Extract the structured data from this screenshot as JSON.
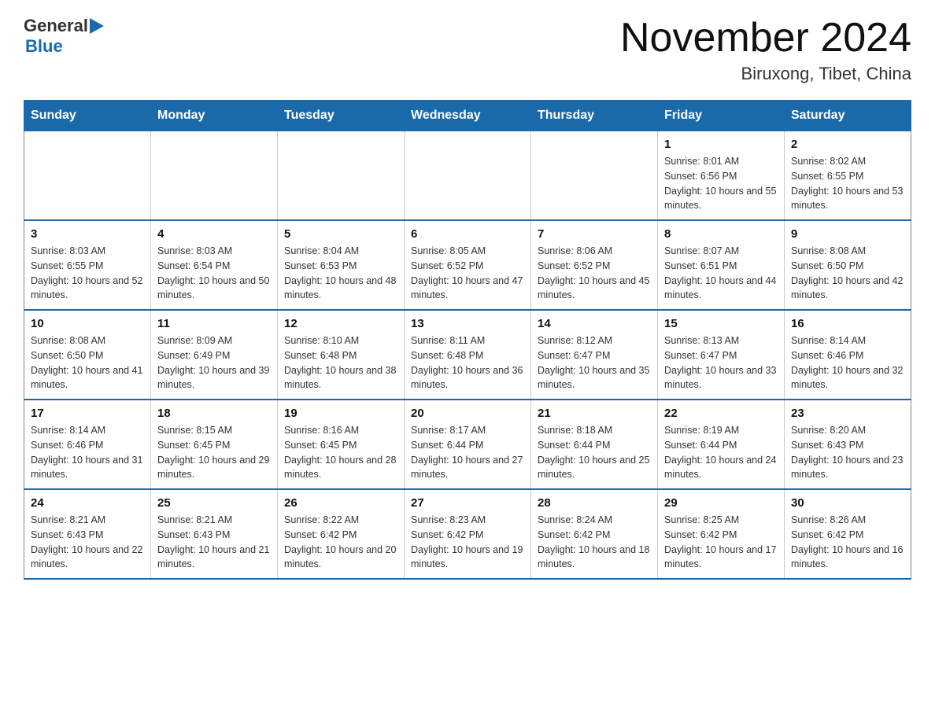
{
  "header": {
    "logo_general": "General",
    "logo_blue": "Blue",
    "month_title": "November 2024",
    "location": "Biruxong, Tibet, China"
  },
  "weekdays": [
    "Sunday",
    "Monday",
    "Tuesday",
    "Wednesday",
    "Thursday",
    "Friday",
    "Saturday"
  ],
  "weeks": [
    [
      {
        "day": "",
        "info": ""
      },
      {
        "day": "",
        "info": ""
      },
      {
        "day": "",
        "info": ""
      },
      {
        "day": "",
        "info": ""
      },
      {
        "day": "",
        "info": ""
      },
      {
        "day": "1",
        "info": "Sunrise: 8:01 AM\nSunset: 6:56 PM\nDaylight: 10 hours and 55 minutes."
      },
      {
        "day": "2",
        "info": "Sunrise: 8:02 AM\nSunset: 6:55 PM\nDaylight: 10 hours and 53 minutes."
      }
    ],
    [
      {
        "day": "3",
        "info": "Sunrise: 8:03 AM\nSunset: 6:55 PM\nDaylight: 10 hours and 52 minutes."
      },
      {
        "day": "4",
        "info": "Sunrise: 8:03 AM\nSunset: 6:54 PM\nDaylight: 10 hours and 50 minutes."
      },
      {
        "day": "5",
        "info": "Sunrise: 8:04 AM\nSunset: 6:53 PM\nDaylight: 10 hours and 48 minutes."
      },
      {
        "day": "6",
        "info": "Sunrise: 8:05 AM\nSunset: 6:52 PM\nDaylight: 10 hours and 47 minutes."
      },
      {
        "day": "7",
        "info": "Sunrise: 8:06 AM\nSunset: 6:52 PM\nDaylight: 10 hours and 45 minutes."
      },
      {
        "day": "8",
        "info": "Sunrise: 8:07 AM\nSunset: 6:51 PM\nDaylight: 10 hours and 44 minutes."
      },
      {
        "day": "9",
        "info": "Sunrise: 8:08 AM\nSunset: 6:50 PM\nDaylight: 10 hours and 42 minutes."
      }
    ],
    [
      {
        "day": "10",
        "info": "Sunrise: 8:08 AM\nSunset: 6:50 PM\nDaylight: 10 hours and 41 minutes."
      },
      {
        "day": "11",
        "info": "Sunrise: 8:09 AM\nSunset: 6:49 PM\nDaylight: 10 hours and 39 minutes."
      },
      {
        "day": "12",
        "info": "Sunrise: 8:10 AM\nSunset: 6:48 PM\nDaylight: 10 hours and 38 minutes."
      },
      {
        "day": "13",
        "info": "Sunrise: 8:11 AM\nSunset: 6:48 PM\nDaylight: 10 hours and 36 minutes."
      },
      {
        "day": "14",
        "info": "Sunrise: 8:12 AM\nSunset: 6:47 PM\nDaylight: 10 hours and 35 minutes."
      },
      {
        "day": "15",
        "info": "Sunrise: 8:13 AM\nSunset: 6:47 PM\nDaylight: 10 hours and 33 minutes."
      },
      {
        "day": "16",
        "info": "Sunrise: 8:14 AM\nSunset: 6:46 PM\nDaylight: 10 hours and 32 minutes."
      }
    ],
    [
      {
        "day": "17",
        "info": "Sunrise: 8:14 AM\nSunset: 6:46 PM\nDaylight: 10 hours and 31 minutes."
      },
      {
        "day": "18",
        "info": "Sunrise: 8:15 AM\nSunset: 6:45 PM\nDaylight: 10 hours and 29 minutes."
      },
      {
        "day": "19",
        "info": "Sunrise: 8:16 AM\nSunset: 6:45 PM\nDaylight: 10 hours and 28 minutes."
      },
      {
        "day": "20",
        "info": "Sunrise: 8:17 AM\nSunset: 6:44 PM\nDaylight: 10 hours and 27 minutes."
      },
      {
        "day": "21",
        "info": "Sunrise: 8:18 AM\nSunset: 6:44 PM\nDaylight: 10 hours and 25 minutes."
      },
      {
        "day": "22",
        "info": "Sunrise: 8:19 AM\nSunset: 6:44 PM\nDaylight: 10 hours and 24 minutes."
      },
      {
        "day": "23",
        "info": "Sunrise: 8:20 AM\nSunset: 6:43 PM\nDaylight: 10 hours and 23 minutes."
      }
    ],
    [
      {
        "day": "24",
        "info": "Sunrise: 8:21 AM\nSunset: 6:43 PM\nDaylight: 10 hours and 22 minutes."
      },
      {
        "day": "25",
        "info": "Sunrise: 8:21 AM\nSunset: 6:43 PM\nDaylight: 10 hours and 21 minutes."
      },
      {
        "day": "26",
        "info": "Sunrise: 8:22 AM\nSunset: 6:42 PM\nDaylight: 10 hours and 20 minutes."
      },
      {
        "day": "27",
        "info": "Sunrise: 8:23 AM\nSunset: 6:42 PM\nDaylight: 10 hours and 19 minutes."
      },
      {
        "day": "28",
        "info": "Sunrise: 8:24 AM\nSunset: 6:42 PM\nDaylight: 10 hours and 18 minutes."
      },
      {
        "day": "29",
        "info": "Sunrise: 8:25 AM\nSunset: 6:42 PM\nDaylight: 10 hours and 17 minutes."
      },
      {
        "day": "30",
        "info": "Sunrise: 8:26 AM\nSunset: 6:42 PM\nDaylight: 10 hours and 16 minutes."
      }
    ]
  ]
}
